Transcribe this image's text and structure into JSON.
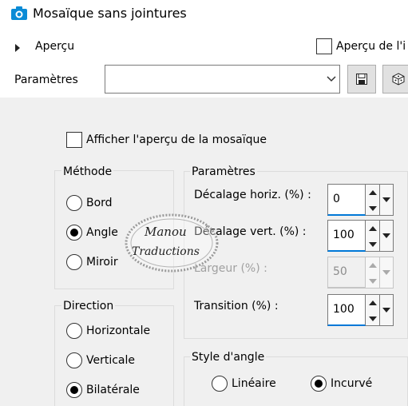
{
  "window": {
    "title": "Mosaïque sans jointures"
  },
  "preview": {
    "toggle_label": "Aperçu",
    "live_preview_label": "Aperçu de l'i"
  },
  "params_row": {
    "label": "Paramètres",
    "preset_value": "",
    "save_icon": "save-icon",
    "random_icon": "dice-icon"
  },
  "show_mosaic_preview": {
    "label": "Afficher l'aperçu de la mosaïque",
    "checked": false
  },
  "method": {
    "title": "Méthode",
    "options": [
      "Bord",
      "Angle",
      "Miroir"
    ],
    "selected": "Angle"
  },
  "direction": {
    "title": "Direction",
    "options": [
      "Horizontale",
      "Verticale",
      "Bilatérale"
    ],
    "selected": "Bilatérale"
  },
  "parameters": {
    "title": "Paramètres",
    "fields": [
      {
        "label": "Décalage horiz. (%) :",
        "value": "0",
        "enabled": true
      },
      {
        "label": "Décalage vert. (%) :",
        "value": "100",
        "enabled": true
      },
      {
        "label": "Largeur (%) :",
        "value": "50",
        "enabled": false
      },
      {
        "label": "Transition (%) :",
        "value": "100",
        "enabled": true
      }
    ]
  },
  "corner_style": {
    "title": "Style d'angle",
    "options": [
      "Linéaire",
      "Incurvé"
    ],
    "selected": "Incurvé"
  },
  "watermark": {
    "line1": "Manou",
    "line2": "Traductions"
  }
}
